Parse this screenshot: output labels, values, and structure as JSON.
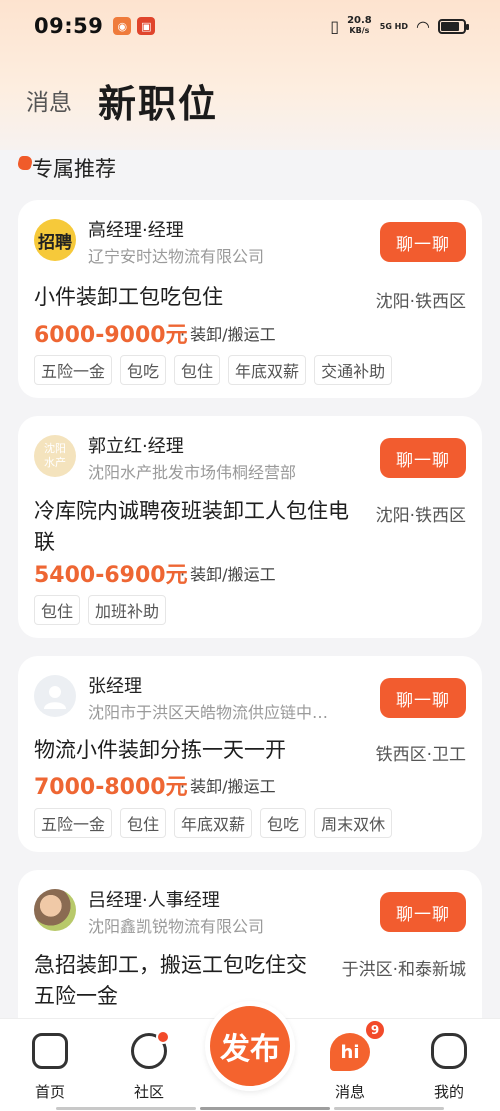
{
  "status_bar": {
    "time": "09:59",
    "net_speed_value": "20.8",
    "net_speed_unit": "KB/s",
    "signal_label": "5G HD"
  },
  "header": {
    "back_label": "消息",
    "title": "新职位"
  },
  "section": {
    "title": "专属推荐"
  },
  "chat_button_label": "聊一聊",
  "jobs": [
    {
      "avatar_text": "招聘",
      "recruiter": "高经理·经理",
      "company": "辽宁安时达物流有限公司",
      "title": "小件装卸工包吃包住",
      "location": "沈阳·铁西区",
      "salary": "6000-9000元",
      "category": "· 装卸/搬运工",
      "tags": [
        "五险一金",
        "包吃",
        "包住",
        "年底双薪",
        "交通补助"
      ]
    },
    {
      "avatar_text": "沈阳\n水产",
      "recruiter": "郭立红·经理",
      "company": "沈阳水产批发市场伟桐经营部",
      "title": "冷库院内诚聘夜班装卸工人包住电联",
      "location": "沈阳·铁西区",
      "salary": "5400-6900元",
      "category": "· 装卸/搬运工",
      "tags": [
        "包住",
        "加班补助"
      ]
    },
    {
      "avatar_text": "",
      "recruiter": "张经理",
      "company": "沈阳市于洪区天皓物流供应链中…",
      "title": "物流小件装卸分拣一天一开",
      "location": "铁西区·卫工",
      "salary": "7000-8000元",
      "category": "· 装卸/搬运工",
      "tags": [
        "五险一金",
        "包住",
        "年底双薪",
        "包吃",
        "周末双休"
      ]
    },
    {
      "avatar_text": "",
      "recruiter": "吕经理·人事经理",
      "company": "沈阳鑫凯锐物流有限公司",
      "title": "急招装卸工，搬运工包吃住交五险一金",
      "location": "于洪区·和泰新城",
      "salary": "",
      "category": "",
      "tags": []
    }
  ],
  "bottom_nav": {
    "home": "首页",
    "community": "社区",
    "publish": "发布",
    "messages": "消息",
    "messages_badge": "9",
    "profile": "我的",
    "hi_text": "hi"
  },
  "colors": {
    "accent": "#f25c2f",
    "salary": "#ee6633"
  }
}
